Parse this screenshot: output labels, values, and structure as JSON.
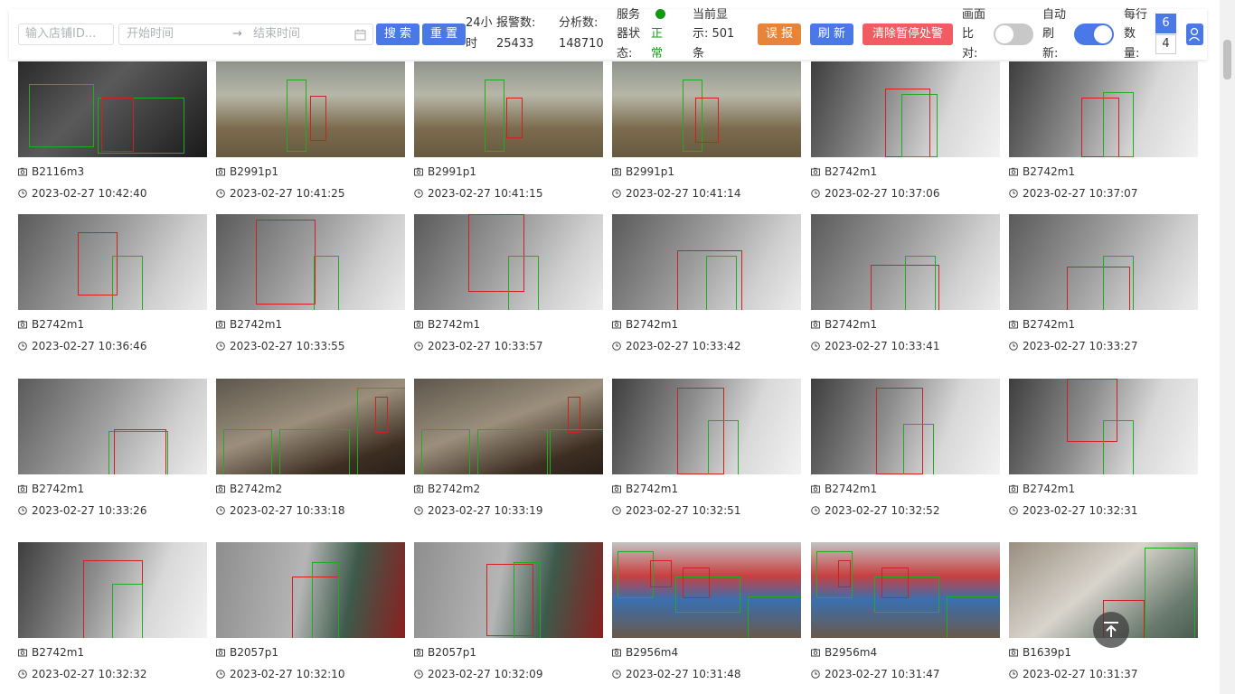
{
  "toolbar": {
    "shop_placeholder": "输入店铺ID...",
    "start_placeholder": "开始时间",
    "range_separator": "→",
    "end_placeholder": "结束时间",
    "search_label": "搜 索",
    "reset_label": "重 置",
    "alarm_24h_label_1": "24小",
    "alarm_24h_label_2": "时",
    "alarm_count_label": "报警数:",
    "alarm_count": "25433",
    "analysis_label": "分析数:",
    "analysis_count": "148710",
    "server_status_label_1": "服务",
    "server_status_label_2": "器状",
    "server_status_label_3": "态:",
    "server_status_value_1": "正",
    "server_status_value_2": "常",
    "current_display_label_1": "当前显",
    "current_display_label_2": "示: 501",
    "current_display_label_3": "条",
    "false_alarm_label": "误 报",
    "refresh_label": "刷 新",
    "clear_label": "清除暂停处警",
    "compare_label_1": "画面",
    "compare_label_2": "比",
    "compare_label_3": "对:",
    "compare_on": false,
    "auto_refresh_label_1": "自动",
    "auto_refresh_label_2": "刷",
    "auto_refresh_label_3": "新:",
    "auto_refresh_on": true,
    "per_row_label_1": "每行",
    "per_row_label_2": "数",
    "per_row_label_3": "量:",
    "per_row_options": [
      "6",
      "4"
    ],
    "per_row_selected": "6",
    "colors": {
      "accent": "#4a78e6",
      "status_ok": "#1a9a1a"
    }
  },
  "cards": [
    {
      "camera": "B2116m3",
      "time": "2023-02-27 10:42:40"
    },
    {
      "camera": "B2991p1",
      "time": "2023-02-27 10:41:25"
    },
    {
      "camera": "B2991p1",
      "time": "2023-02-27 10:41:15"
    },
    {
      "camera": "B2991p1",
      "time": "2023-02-27 10:41:14"
    },
    {
      "camera": "B2742m1",
      "time": "2023-02-27 10:37:06"
    },
    {
      "camera": "B2742m1",
      "time": "2023-02-27 10:37:07"
    },
    {
      "camera": "B2742m1",
      "time": "2023-02-27 10:36:46"
    },
    {
      "camera": "B2742m1",
      "time": "2023-02-27 10:33:55"
    },
    {
      "camera": "B2742m1",
      "time": "2023-02-27 10:33:57"
    },
    {
      "camera": "B2742m1",
      "time": "2023-02-27 10:33:42"
    },
    {
      "camera": "B2742m1",
      "time": "2023-02-27 10:33:41"
    },
    {
      "camera": "B2742m1",
      "time": "2023-02-27 10:33:27"
    },
    {
      "camera": "B2742m1",
      "time": "2023-02-27 10:33:26"
    },
    {
      "camera": "B2742m2",
      "time": "2023-02-27 10:33:18"
    },
    {
      "camera": "B2742m2",
      "time": "2023-02-27 10:33:19"
    },
    {
      "camera": "B2742m1",
      "time": "2023-02-27 10:32:51"
    },
    {
      "camera": "B2742m1",
      "time": "2023-02-27 10:32:52"
    },
    {
      "camera": "B2742m1",
      "time": "2023-02-27 10:32:31"
    },
    {
      "camera": "B2742m1",
      "time": "2023-02-27 10:32:32"
    },
    {
      "camera": "B2057p1",
      "time": "2023-02-27 10:32:10"
    },
    {
      "camera": "B2057p1",
      "time": "2023-02-27 10:32:09"
    },
    {
      "camera": "B2956m4",
      "time": "2023-02-27 10:31:48"
    },
    {
      "camera": "B2956m4",
      "time": "2023-02-27 10:31:47"
    },
    {
      "camera": "B1639p1",
      "time": "2023-02-27 10:31:37"
    }
  ]
}
